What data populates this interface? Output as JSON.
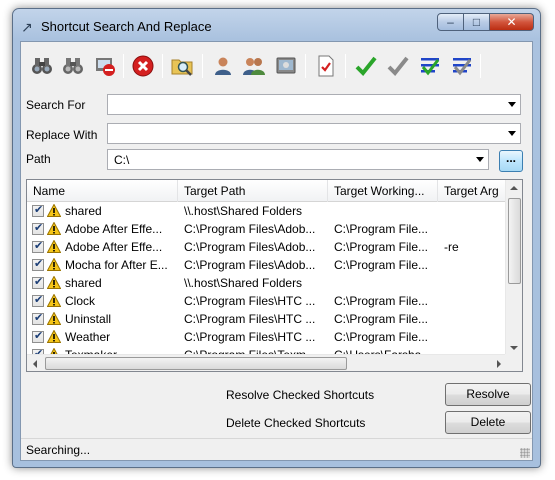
{
  "window": {
    "title": "Shortcut Search And Replace"
  },
  "toolbar": {
    "buttons": [
      {
        "icon": "binoculars-icon"
      },
      {
        "icon": "binoculars-next-icon"
      },
      {
        "icon": "delete-shortcut-icon"
      },
      {
        "icon": "stop-icon"
      },
      {
        "icon": "folder-search-icon"
      },
      {
        "icon": "user-icon"
      },
      {
        "icon": "users-icon"
      },
      {
        "icon": "computer-icon"
      },
      {
        "icon": "check-document-icon"
      },
      {
        "icon": "check-all-icon"
      },
      {
        "icon": "check-icon"
      },
      {
        "icon": "check-lines-icon"
      },
      {
        "icon": "uncheck-lines-icon"
      }
    ]
  },
  "form": {
    "search_for_label": "Search For",
    "search_for_value": "",
    "replace_with_label": "Replace With",
    "replace_with_value": "",
    "path_label": "Path",
    "path_value": "C:\\",
    "browse_label": "..."
  },
  "list": {
    "columns": [
      "Name",
      "Target Path",
      "Target Working...",
      "Target Arg"
    ],
    "rows": [
      {
        "name": "shared",
        "target_path": "\\\\.host\\Shared Folders",
        "working": "",
        "args": ""
      },
      {
        "name": "Adobe After Effe...",
        "target_path": "C:\\Program Files\\Adob...",
        "working": "C:\\Program File...",
        "args": ""
      },
      {
        "name": "Adobe After Effe...",
        "target_path": "C:\\Program Files\\Adob...",
        "working": "C:\\Program File...",
        "args": "-re"
      },
      {
        "name": "Mocha for After E...",
        "target_path": "C:\\Program Files\\Adob...",
        "working": "C:\\Program File...",
        "args": ""
      },
      {
        "name": "shared",
        "target_path": "\\\\.host\\Shared Folders",
        "working": "",
        "args": ""
      },
      {
        "name": "Clock",
        "target_path": "C:\\Program Files\\HTC ...",
        "working": "C:\\Program File...",
        "args": ""
      },
      {
        "name": "Uninstall",
        "target_path": "C:\\Program Files\\HTC ...",
        "working": "C:\\Program File...",
        "args": ""
      },
      {
        "name": "Weather",
        "target_path": "C:\\Program Files\\HTC ...",
        "working": "C:\\Program File...",
        "args": ""
      },
      {
        "name": "Texmaker",
        "target_path": "C:\\Program Files\\Texm...",
        "working": "C:\\Users\\Farsha...",
        "args": ""
      }
    ]
  },
  "actions": {
    "resolve_label": "Resolve Checked Shortcuts",
    "resolve_button": "Resolve",
    "delete_label": "Delete Checked Shortcuts",
    "delete_button": "Delete"
  },
  "status": {
    "text": "Searching..."
  },
  "colors": {
    "accent_green": "#2aa52a",
    "stop_red": "#d42020",
    "title_bar": "#b9cde5"
  }
}
